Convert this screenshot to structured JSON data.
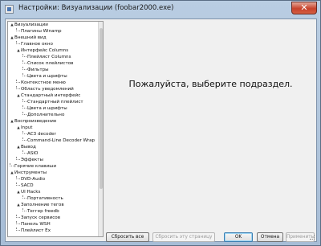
{
  "window": {
    "title": "Настройки: Визуализации (foobar2000.exe)",
    "close_label": "✕"
  },
  "tree": {
    "items": [
      {
        "label": "Визуализации",
        "expander": "▲"
      },
      {
        "label": "Плагины Winamp"
      },
      {
        "label": "Внешний вид",
        "expander": "▲"
      },
      {
        "label": "Главное окно"
      },
      {
        "label": "Интерфейс Columns",
        "expander": "▲"
      },
      {
        "label": "Плейлист Columns"
      },
      {
        "label": "Список плейлистов"
      },
      {
        "label": "Фильтры"
      },
      {
        "label": "Цвета и шрифты"
      },
      {
        "label": "Контекстное меню"
      },
      {
        "label": "Область уведомлений"
      },
      {
        "label": "Стандартный интерфейс",
        "expander": "▲"
      },
      {
        "label": "Стандартный плейлист"
      },
      {
        "label": "Цвета и шрифты"
      },
      {
        "label": "Дополнительно"
      },
      {
        "label": "Воспроизведение",
        "expander": "▲"
      },
      {
        "label": "Input",
        "expander": "▲"
      },
      {
        "label": "AC3 decoder"
      },
      {
        "label": "Command-Line Decoder Wrap"
      },
      {
        "label": "Вывод",
        "expander": "▲"
      },
      {
        "label": "ASIO"
      },
      {
        "label": "Эффекты"
      },
      {
        "label": "Горячие клавиши"
      },
      {
        "label": "Инструменты",
        "expander": "▲"
      },
      {
        "label": "DVD-Audio"
      },
      {
        "label": "SACD"
      },
      {
        "label": "UI Hacks",
        "expander": "▲"
      },
      {
        "label": "Портативность"
      },
      {
        "label": "Заполнение тегов",
        "expander": "▲"
      },
      {
        "label": "Теггер freedb"
      },
      {
        "label": "Запуск сервисов"
      },
      {
        "label": "Панель WSH"
      },
      {
        "label": "Плейлист Ex"
      }
    ]
  },
  "content": {
    "prompt": "Пожалуйста, выберите подраздел."
  },
  "buttons": {
    "reset_all": "Сбросить все",
    "reset_page": "Сбросить эту страницу",
    "ok": "OK",
    "cancel": "Отмена",
    "apply": "Применить"
  }
}
